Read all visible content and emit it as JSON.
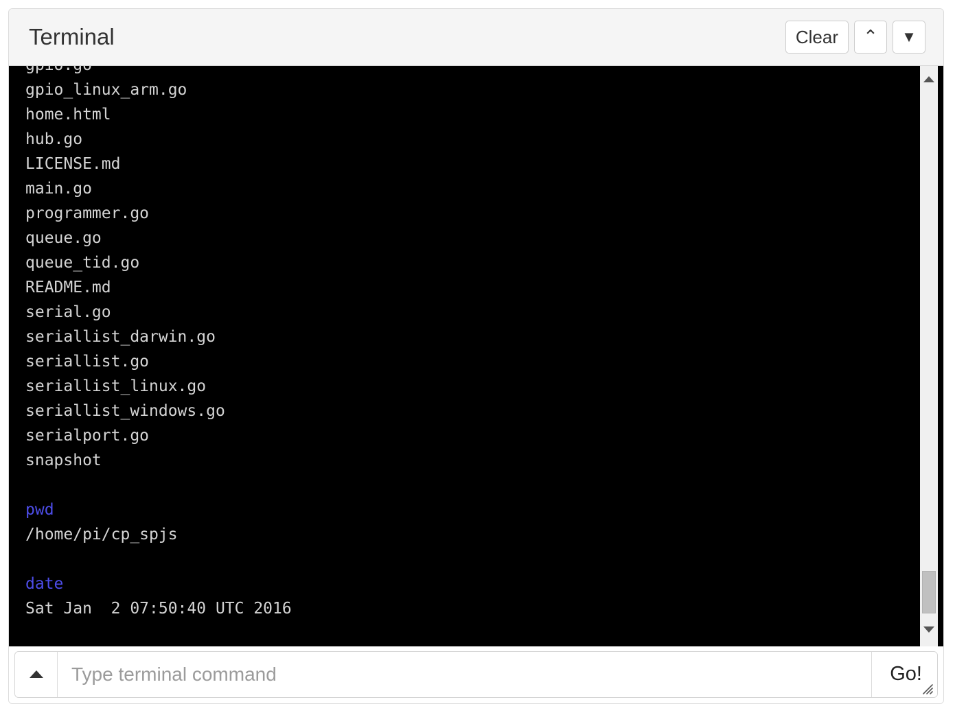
{
  "window": {
    "title": "Terminal"
  },
  "header": {
    "clear_label": "Clear",
    "scroll_up_glyph": "",
    "caret_up_glyph": "⌃",
    "triangle_down_glyph": "▼",
    "buttons": [
      {
        "name": "clear-button",
        "label": "Clear"
      },
      {
        "name": "chevron-up-button",
        "label": "⌃"
      },
      {
        "name": "triangle-down-button",
        "label": "▼"
      }
    ]
  },
  "terminal": {
    "background_color": "#000000",
    "text_color": "#d4d4d4",
    "command_color": "#4d4de8",
    "lines": [
      {
        "text": "gpio.go",
        "type": "output",
        "clipped": true
      },
      {
        "text": "gpio_linux_arm.go",
        "type": "output"
      },
      {
        "text": "home.html",
        "type": "output"
      },
      {
        "text": "hub.go",
        "type": "output"
      },
      {
        "text": "LICENSE.md",
        "type": "output"
      },
      {
        "text": "main.go",
        "type": "output"
      },
      {
        "text": "programmer.go",
        "type": "output"
      },
      {
        "text": "queue.go",
        "type": "output"
      },
      {
        "text": "queue_tid.go",
        "type": "output"
      },
      {
        "text": "README.md",
        "type": "output"
      },
      {
        "text": "serial.go",
        "type": "output"
      },
      {
        "text": "seriallist_darwin.go",
        "type": "output"
      },
      {
        "text": "seriallist.go",
        "type": "output"
      },
      {
        "text": "seriallist_linux.go",
        "type": "output"
      },
      {
        "text": "seriallist_windows.go",
        "type": "output"
      },
      {
        "text": "serialport.go",
        "type": "output"
      },
      {
        "text": "snapshot",
        "type": "output"
      },
      {
        "text": "",
        "type": "blank"
      },
      {
        "text": "pwd",
        "type": "command"
      },
      {
        "text": "/home/pi/cp_spjs",
        "type": "output"
      },
      {
        "text": "",
        "type": "blank"
      },
      {
        "text": "date",
        "type": "command"
      },
      {
        "text": "Sat Jan  2 07:50:40 UTC 2016",
        "type": "output"
      }
    ]
  },
  "scrollbar": {
    "up_arrow": "scroll-up-arrow",
    "down_arrow": "scroll-down-arrow",
    "thumb": "scroll-thumb"
  },
  "input": {
    "history_button": "previous-command",
    "placeholder": "Type terminal command",
    "value": "",
    "submit_label": "Go!"
  }
}
